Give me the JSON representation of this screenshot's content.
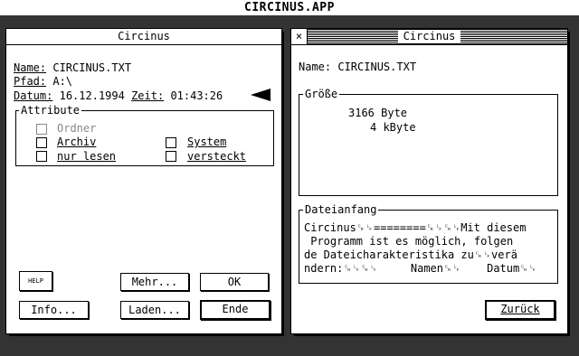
{
  "app_title": "CIRCINUS.APP",
  "left_window": {
    "title": "Circinus",
    "name_label": "Name:",
    "name_value": "CIRCINUS.TXT",
    "path_label": "Pfad:",
    "path_value": "A:\\",
    "date_label": "Datum:",
    "date_value": "16.12.1994",
    "time_label": "Zeit:",
    "time_value": "01:43:26",
    "attributes_label": "Attribute",
    "attributes": {
      "folder": "Ordner",
      "archive": "Archiv",
      "system": "System",
      "readonly": "nur lesen",
      "hidden": "versteckt"
    },
    "help_label": "HELP",
    "more_label": "Mehr...",
    "ok_label": "OK",
    "info_label": "Info...",
    "load_label": "Laden...",
    "end_label": "Ende"
  },
  "right_window": {
    "title": "Circinus",
    "close_glyph": "×",
    "name_line": "Name: CIRCINUS.TXT",
    "size_label": "Größe",
    "size_bytes": "3166 Byte",
    "size_kbytes": "4 kByte",
    "file_start_label": "Dateianfang",
    "preview_lines": [
      "Circinus␍␊========␍␊␍␊Mit diesem",
      " Programm ist es möglich, folgen",
      "de Dateicharakteristika zu␍␊verä",
      "ndern:␍␊␍␊     Namen␍␊    Datum␍␊"
    ],
    "back_label": "Zurück"
  }
}
